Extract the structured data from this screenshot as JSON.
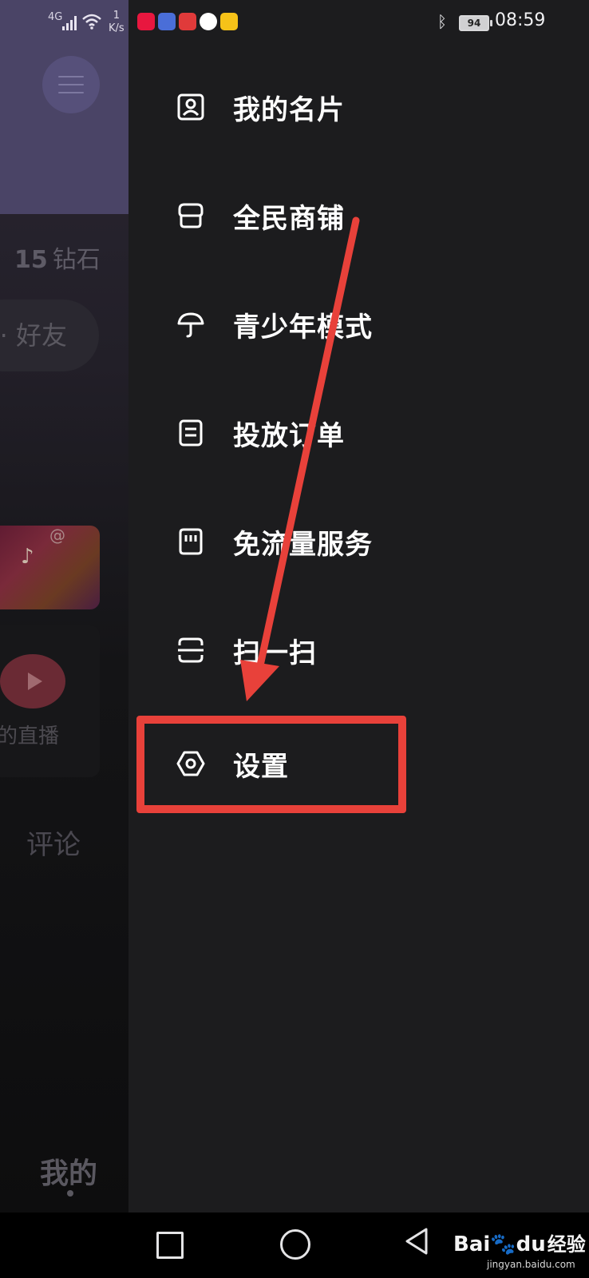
{
  "status_bar": {
    "network": "4G",
    "speed_value": "1",
    "speed_unit": "K/s",
    "battery": "94",
    "time": "08:59"
  },
  "background": {
    "diamond_count": "15",
    "diamond_label": "钻石",
    "friend_label": "· 好友",
    "live_label": "我的直播",
    "comment_label": "评论",
    "mine_tab": "我的"
  },
  "drawer": {
    "items": [
      {
        "label": "我的名片",
        "icon": "id-card-icon"
      },
      {
        "label": "全民商铺",
        "icon": "shop-icon"
      },
      {
        "label": "青少年模式",
        "icon": "umbrella-icon"
      },
      {
        "label": "投放订单",
        "icon": "order-icon"
      },
      {
        "label": "免流量服务",
        "icon": "sim-card-icon"
      },
      {
        "label": "扫一扫",
        "icon": "scan-icon"
      },
      {
        "label": "设置",
        "icon": "settings-icon"
      }
    ]
  },
  "annotation": {
    "color": "#e8413a"
  },
  "watermark": {
    "brand": "Bai",
    "brand_suffix": "du",
    "cn": "经验",
    "url": "jingyan.baidu.com"
  }
}
